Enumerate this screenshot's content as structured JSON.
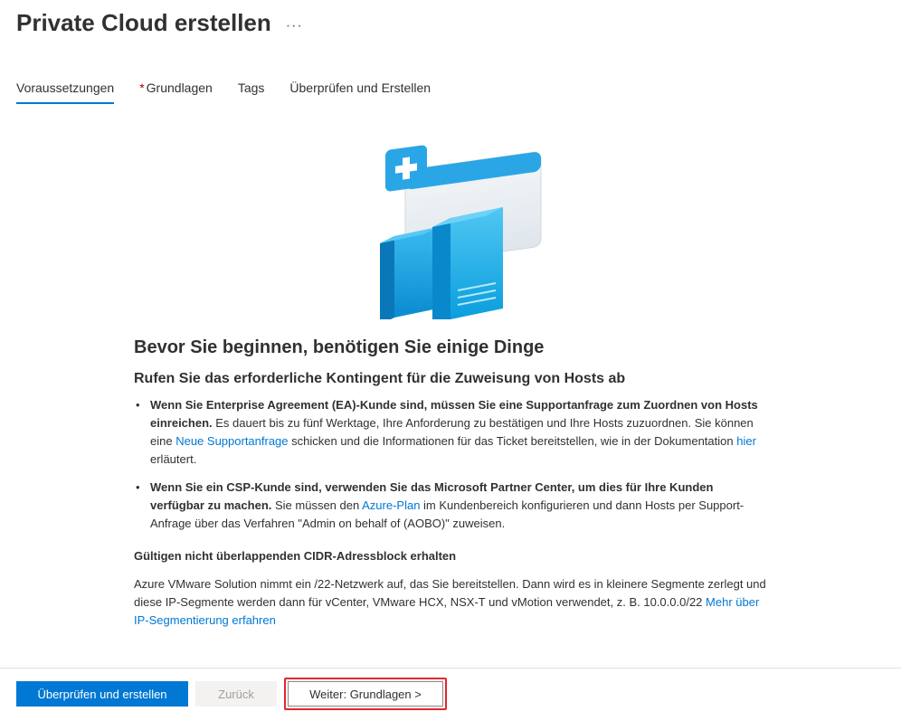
{
  "header": {
    "title": "Private Cloud erstellen"
  },
  "tabs": [
    {
      "label": "Voraussetzungen",
      "active": true,
      "required": false
    },
    {
      "label": "Grundlagen",
      "active": false,
      "required": true
    },
    {
      "label": "Tags",
      "active": false,
      "required": false
    },
    {
      "label": "Überprüfen und Erstellen",
      "active": false,
      "required": false
    }
  ],
  "content": {
    "heading_main": "Bevor Sie beginnen, benötigen Sie einige Dinge",
    "heading_quota": "Rufen Sie das erforderliche Kontingent für die Zuweisung von Hosts ab",
    "bullet_ea_lead": "Wenn Sie Enterprise Agreement (EA)-Kunde sind, müssen Sie eine Supportanfrage zum Zuordnen von Hosts einreichen.",
    "bullet_ea_pre": " Es dauert bis zu fünf Werktage, Ihre Anforderung zu bestätigen und Ihre Hosts zuzuordnen. Sie können eine ",
    "link_new_support": "Neue Supportanfrage",
    "bullet_ea_mid": " schicken und die Informationen für das Ticket bereitstellen, wie in der Dokumentation ",
    "link_hier": "hier",
    "bullet_ea_end": " erläutert.",
    "bullet_csp_lead": "Wenn Sie ein CSP-Kunde sind, verwenden Sie das Microsoft Partner Center, um dies für Ihre Kunden verfügbar zu machen.",
    "bullet_csp_pre": " Sie müssen den ",
    "link_azure_plan": "Azure-Plan",
    "bullet_csp_end": " im Kundenbereich konfigurieren und dann Hosts per Support-Anfrage über das Verfahren \"Admin on behalf of (AOBO)\" zuweisen.",
    "heading_cidr": "Gültigen nicht überlappenden CIDR-Adressblock erhalten",
    "para_cidr_pre": "Azure VMware Solution nimmt ein /22-Netzwerk auf, das Sie bereitstellen. Dann wird es in kleinere Segmente zerlegt und diese IP-Segmente werden dann für vCenter, VMware HCX, NSX-T und vMotion verwendet, z. B. 10.0.0.0/22 ",
    "link_ip_seg": "Mehr über IP-Segmentierung erfahren"
  },
  "footer": {
    "review_create": "Überprüfen und erstellen",
    "back": "Zurück",
    "next": "Weiter: Grundlagen  >"
  }
}
